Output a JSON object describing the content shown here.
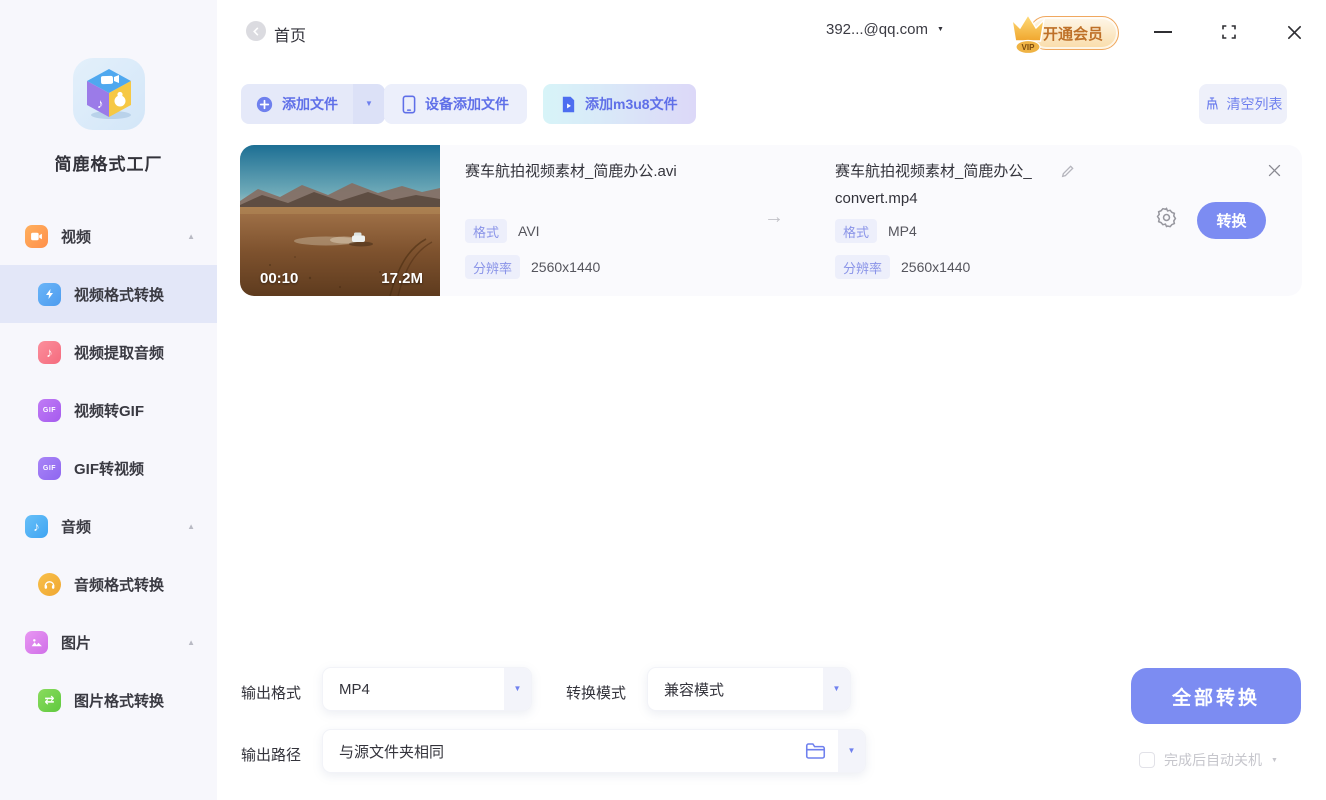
{
  "app": {
    "name": "简鹿格式工厂"
  },
  "header": {
    "home": "首页",
    "account": "392...@qq.com",
    "vip_tag": "VIP",
    "vip_label": "开通会员"
  },
  "toolbar": {
    "add_file": "添加文件",
    "add_device": "设备添加文件",
    "add_m3u8": "添加m3u8文件",
    "clear_list": "清空列表"
  },
  "sidebar": {
    "groups": [
      {
        "label": "视频",
        "items": [
          "视频格式转换",
          "视频提取音频",
          "视频转GIF",
          "GIF转视频"
        ]
      },
      {
        "label": "音频",
        "items": [
          "音频格式转换"
        ]
      },
      {
        "label": "图片",
        "items": [
          "图片格式转换"
        ]
      }
    ],
    "selected": "视频格式转换",
    "gif_icon_text": "GIF"
  },
  "file": {
    "duration": "00:10",
    "size": "17.2M",
    "source": {
      "name": "赛车航拍视频素材_简鹿办公.avi",
      "format_label": "格式",
      "format": "AVI",
      "resolution_label": "分辨率",
      "resolution": "2560x1440"
    },
    "target": {
      "name_line1": "赛车航拍视频素材_简鹿办公_",
      "name_line2": "convert.mp4",
      "format_label": "格式",
      "format": "MP4",
      "resolution_label": "分辨率",
      "resolution": "2560x1440"
    },
    "convert_label": "转换"
  },
  "footer": {
    "output_format_label": "输出格式",
    "output_format_value": "MP4",
    "convert_mode_label": "转换模式",
    "convert_mode_value": "兼容模式",
    "output_path_label": "输出路径",
    "output_path_value": "与源文件夹相同",
    "convert_all": "全部转换",
    "shutdown": "完成后自动关机"
  },
  "colors": {
    "accent": "#7C8CF2",
    "accent_text": "#5F6FE8",
    "badge_bg": "#EDEFFB",
    "badge_text": "#8A94E8",
    "sidebar_bg": "#F7F7FC",
    "selected_bg": "#E3E7F8",
    "vip_border": "#F0A85F",
    "vip_text": "#BE7028"
  }
}
